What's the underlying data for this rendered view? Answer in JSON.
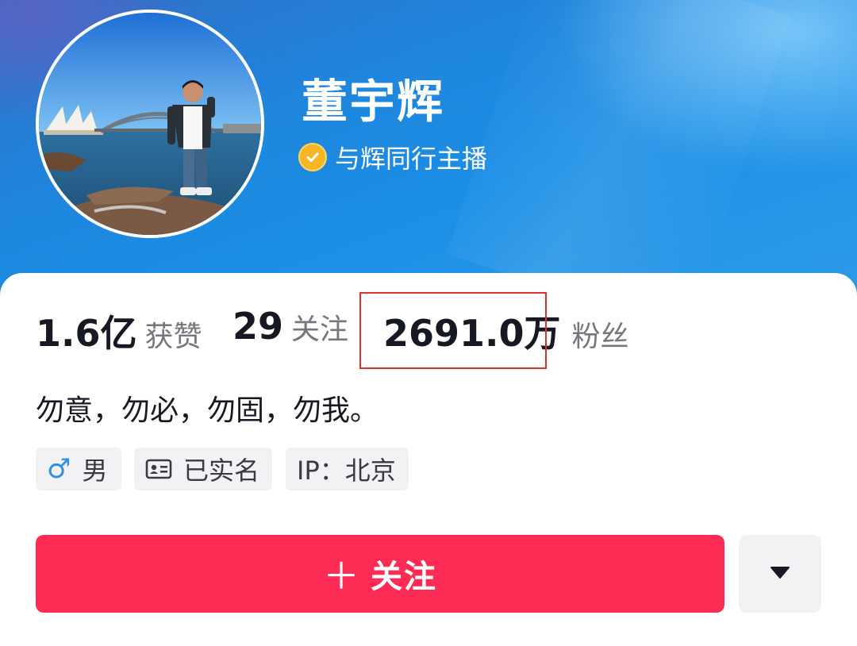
{
  "profile": {
    "name": "董宇辉",
    "verification": "与辉同行主播",
    "verify_color": "#f6b626"
  },
  "stats": [
    {
      "value": "1.6亿",
      "label": "获赞"
    },
    {
      "value": "29",
      "label": "关注"
    },
    {
      "value": "2691.0万",
      "label": "粉丝"
    }
  ],
  "bio": "勿意，勿必，勿固，勿我。",
  "tags": {
    "gender_symbol": "♂",
    "gender": "男",
    "realname": "已实名",
    "ip": "IP：北京"
  },
  "actions": {
    "follow_plus": "＋",
    "follow_label": "关注",
    "follow_color": "#fe2c55"
  },
  "icons": [
    "verified-badge-icon",
    "male-icon",
    "id-card-icon",
    "dropdown-triangle-icon"
  ]
}
